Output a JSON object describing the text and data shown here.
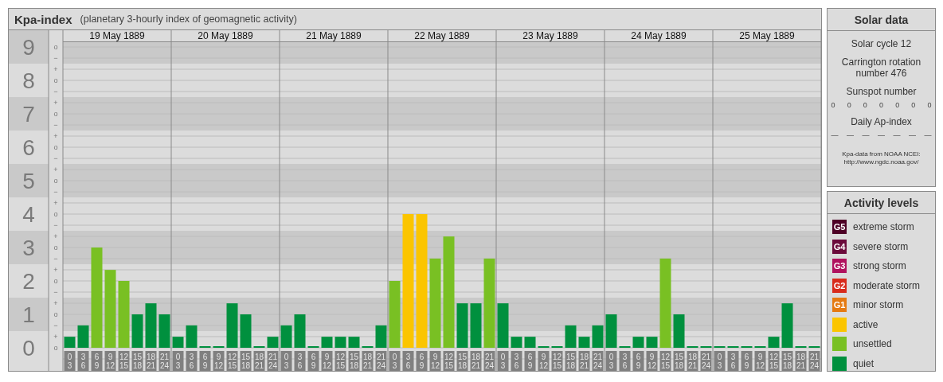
{
  "title": "Kpa-index",
  "subtitle": "(planetary 3-hourly index of geomagnetic activity)",
  "y_axis": [
    {
      "marks": [
        {
          "kind": "center",
          "text": "o"
        },
        {
          "kind": "below",
          "text": "−"
        }
      ]
    },
    {
      "marks": [
        {
          "kind": "above",
          "text": "+"
        },
        {
          "kind": "center",
          "text": "o"
        },
        {
          "kind": "below",
          "text": "−"
        }
      ]
    },
    {
      "marks": [
        {
          "kind": "above",
          "text": "+"
        },
        {
          "kind": "center",
          "text": "o"
        },
        {
          "kind": "below",
          "text": "−"
        }
      ]
    },
    {
      "marks": [
        {
          "kind": "above",
          "text": "+"
        },
        {
          "kind": "center",
          "text": "o"
        },
        {
          "kind": "below",
          "text": "−"
        }
      ]
    },
    {
      "marks": [
        {
          "kind": "above",
          "text": "+"
        },
        {
          "kind": "center",
          "text": "o"
        },
        {
          "kind": "below",
          "text": "−"
        }
      ]
    },
    {
      "marks": [
        {
          "kind": "above",
          "text": "+"
        },
        {
          "kind": "center",
          "text": "o"
        },
        {
          "kind": "below",
          "text": "−"
        }
      ]
    },
    {
      "marks": [
        {
          "kind": "above",
          "text": "+"
        },
        {
          "kind": "center",
          "text": "o"
        },
        {
          "kind": "below",
          "text": "−"
        }
      ]
    },
    {
      "marks": [
        {
          "kind": "above",
          "text": "+"
        },
        {
          "kind": "center",
          "text": "o"
        },
        {
          "kind": "below",
          "text": "−"
        }
      ]
    },
    {
      "marks": [
        {
          "kind": "above",
          "text": "+"
        },
        {
          "kind": "center",
          "text": "o"
        },
        {
          "kind": "below",
          "text": "−"
        }
      ]
    },
    {
      "marks": [
        {
          "kind": "above",
          "text": "+"
        },
        {
          "kind": "center",
          "text": "o"
        }
      ]
    }
  ],
  "days": [
    {
      "date": "19 May 1889",
      "slots": [
        {
          "start": "0",
          "end": "3"
        },
        {
          "start": "3",
          "end": "6"
        },
        {
          "start": "6",
          "end": "9"
        },
        {
          "start": "9",
          "end": "12"
        },
        {
          "start": "12",
          "end": "15"
        },
        {
          "start": "15",
          "end": "18"
        },
        {
          "start": "18",
          "end": "21"
        },
        {
          "start": "21",
          "end": "24"
        }
      ]
    },
    {
      "date": "20 May 1889",
      "slots": [
        {
          "start": "0",
          "end": "3"
        },
        {
          "start": "3",
          "end": "6"
        },
        {
          "start": "6",
          "end": "9"
        },
        {
          "start": "9",
          "end": "12"
        },
        {
          "start": "12",
          "end": "15"
        },
        {
          "start": "15",
          "end": "18"
        },
        {
          "start": "18",
          "end": "21"
        },
        {
          "start": "21",
          "end": "24"
        }
      ]
    },
    {
      "date": "21 May 1889",
      "slots": [
        {
          "start": "0",
          "end": "3"
        },
        {
          "start": "3",
          "end": "6"
        },
        {
          "start": "6",
          "end": "9"
        },
        {
          "start": "9",
          "end": "12"
        },
        {
          "start": "12",
          "end": "15"
        },
        {
          "start": "15",
          "end": "18"
        },
        {
          "start": "18",
          "end": "21"
        },
        {
          "start": "21",
          "end": "24"
        }
      ]
    },
    {
      "date": "22 May 1889",
      "slots": [
        {
          "start": "0",
          "end": "3"
        },
        {
          "start": "3",
          "end": "6"
        },
        {
          "start": "6",
          "end": "9"
        },
        {
          "start": "9",
          "end": "12"
        },
        {
          "start": "12",
          "end": "15"
        },
        {
          "start": "15",
          "end": "18"
        },
        {
          "start": "18",
          "end": "21"
        },
        {
          "start": "21",
          "end": "24"
        }
      ]
    },
    {
      "date": "23 May 1889",
      "slots": [
        {
          "start": "0",
          "end": "3"
        },
        {
          "start": "3",
          "end": "6"
        },
        {
          "start": "6",
          "end": "9"
        },
        {
          "start": "9",
          "end": "12"
        },
        {
          "start": "12",
          "end": "15"
        },
        {
          "start": "15",
          "end": "18"
        },
        {
          "start": "18",
          "end": "21"
        },
        {
          "start": "21",
          "end": "24"
        }
      ]
    },
    {
      "date": "24 May 1889",
      "slots": [
        {
          "start": "0",
          "end": "3"
        },
        {
          "start": "3",
          "end": "6"
        },
        {
          "start": "6",
          "end": "9"
        },
        {
          "start": "9",
          "end": "12"
        },
        {
          "start": "12",
          "end": "15"
        },
        {
          "start": "15",
          "end": "18"
        },
        {
          "start": "18",
          "end": "21"
        },
        {
          "start": "21",
          "end": "24"
        }
      ]
    },
    {
      "date": "25 May 1889",
      "slots": [
        {
          "start": "0",
          "end": "3"
        },
        {
          "start": "3",
          "end": "6"
        },
        {
          "start": "6",
          "end": "9"
        },
        {
          "start": "9",
          "end": "12"
        },
        {
          "start": "12",
          "end": "15"
        },
        {
          "start": "15",
          "end": "18"
        },
        {
          "start": "18",
          "end": "21"
        },
        {
          "start": "21",
          "end": "24"
        }
      ]
    }
  ],
  "chart_data": {
    "type": "bar",
    "categories": [
      null,
      null,
      null,
      null,
      null,
      null,
      null,
      null,
      null,
      null,
      null,
      null,
      null,
      null,
      null,
      null,
      null,
      null,
      null,
      null,
      null,
      null,
      null,
      null,
      null,
      null,
      null,
      null,
      null,
      null,
      null,
      null,
      null,
      null,
      null,
      null,
      null,
      null,
      null,
      null,
      null,
      null,
      null,
      null,
      null,
      null,
      null,
      null,
      null,
      null,
      null,
      null,
      null,
      null,
      null,
      null
    ],
    "grid": true,
    "ylim": [
      0,
      9
    ],
    "bands": [
      {
        "axis": "y",
        "from": 0.5,
        "to": 1.5
      },
      {
        "axis": "y",
        "from": 2.5,
        "to": 3.5
      },
      {
        "axis": "y",
        "from": 4.5,
        "to": 5.5
      },
      {
        "axis": "y",
        "from": 6.5,
        "to": 7.5
      },
      {
        "axis": "y",
        "from": 8.5,
        "to": 9.17
      }
    ],
    "yticks": [
      9,
      8,
      7,
      6,
      5,
      4,
      3,
      2,
      1,
      0
    ],
    "values": [
      0.33,
      0.67,
      3,
      2.33,
      2,
      1,
      1.33,
      1,
      0.33,
      0.67,
      0,
      0,
      1.33,
      1,
      0,
      0.33,
      0.67,
      1,
      0,
      0.33,
      0.33,
      0.33,
      0,
      0.67,
      2,
      4,
      4,
      2.67,
      3.33,
      1.33,
      1.33,
      2.67,
      1.33,
      0.33,
      0.33,
      0,
      0,
      0.67,
      0.33,
      0.67,
      1,
      0,
      0.33,
      0.33,
      2.67,
      1,
      0,
      0,
      0,
      0,
      0,
      0,
      0.33,
      1.33,
      0,
      0
    ]
  },
  "solar": {
    "title": "Solar data",
    "cycle": "Solar cycle 12",
    "carrington": "Carrington rotation number 476",
    "sunspot_label": "Sunspot number",
    "sunspot_values": [
      "0",
      "0",
      "0",
      "0",
      "0",
      "0",
      "0"
    ],
    "ap_label": "Daily Ap-index",
    "ap_values": [
      "—",
      "—",
      "—",
      "—",
      "—",
      "—",
      "—"
    ],
    "source": "Kpa-data from NOAA NCEI:",
    "source_url": "http://www.ngdc.noaa.gov/"
  },
  "legend": {
    "title": "Activity levels",
    "items": [
      {
        "badge": "G5",
        "label": "extreme storm",
        "color": "#4d0025"
      },
      {
        "badge": "G4",
        "label": "severe storm",
        "color": "#6b0a3b"
      },
      {
        "badge": "G3",
        "label": "strong storm",
        "color": "#b0125e"
      },
      {
        "badge": "G2",
        "label": "moderate storm",
        "color": "#d82b1c"
      },
      {
        "badge": "G1",
        "label": "minor storm",
        "color": "#e57a12"
      },
      {
        "label": "active",
        "color": "#fbc500"
      },
      {
        "label": "unsettled",
        "color": "#79c023"
      },
      {
        "label": "quiet",
        "color": "#00903e"
      }
    ]
  }
}
